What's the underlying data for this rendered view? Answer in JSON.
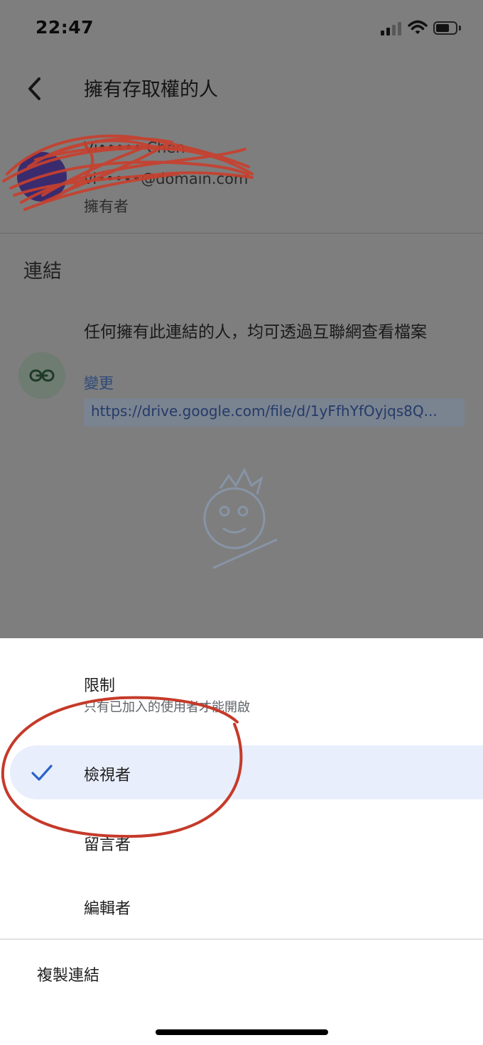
{
  "status_bar": {
    "time": "22:47"
  },
  "header": {
    "title": "擁有存取權的人"
  },
  "owner": {
    "name": "Vi••••• Chen",
    "email": "vi•••••@domain.com",
    "role": "擁有者"
  },
  "link_section": {
    "title": "連結",
    "description": "任何擁有此連結的人，均可透過互聯網查看檔案",
    "change_label": "變更",
    "url": "https://drive.google.com/file/d/1yFfhYfOyjqs8Q..."
  },
  "permission_sheet": {
    "options": [
      {
        "label": "限制",
        "sublabel": "只有已加入的使用者才能開啟",
        "selected": false
      },
      {
        "label": "檢視者",
        "selected": true
      },
      {
        "label": "留言者",
        "selected": false
      },
      {
        "label": "編輯者",
        "selected": false
      }
    ],
    "copy_link_label": "複製連結"
  },
  "colors": {
    "accent": "#1a73e8",
    "selected_bg": "#e8eefb",
    "annotation_red": "#c53a2a"
  },
  "icons": [
    "back-arrow-icon",
    "link-icon",
    "checkmark-icon",
    "signal-icon",
    "wifi-icon",
    "battery-icon"
  ]
}
